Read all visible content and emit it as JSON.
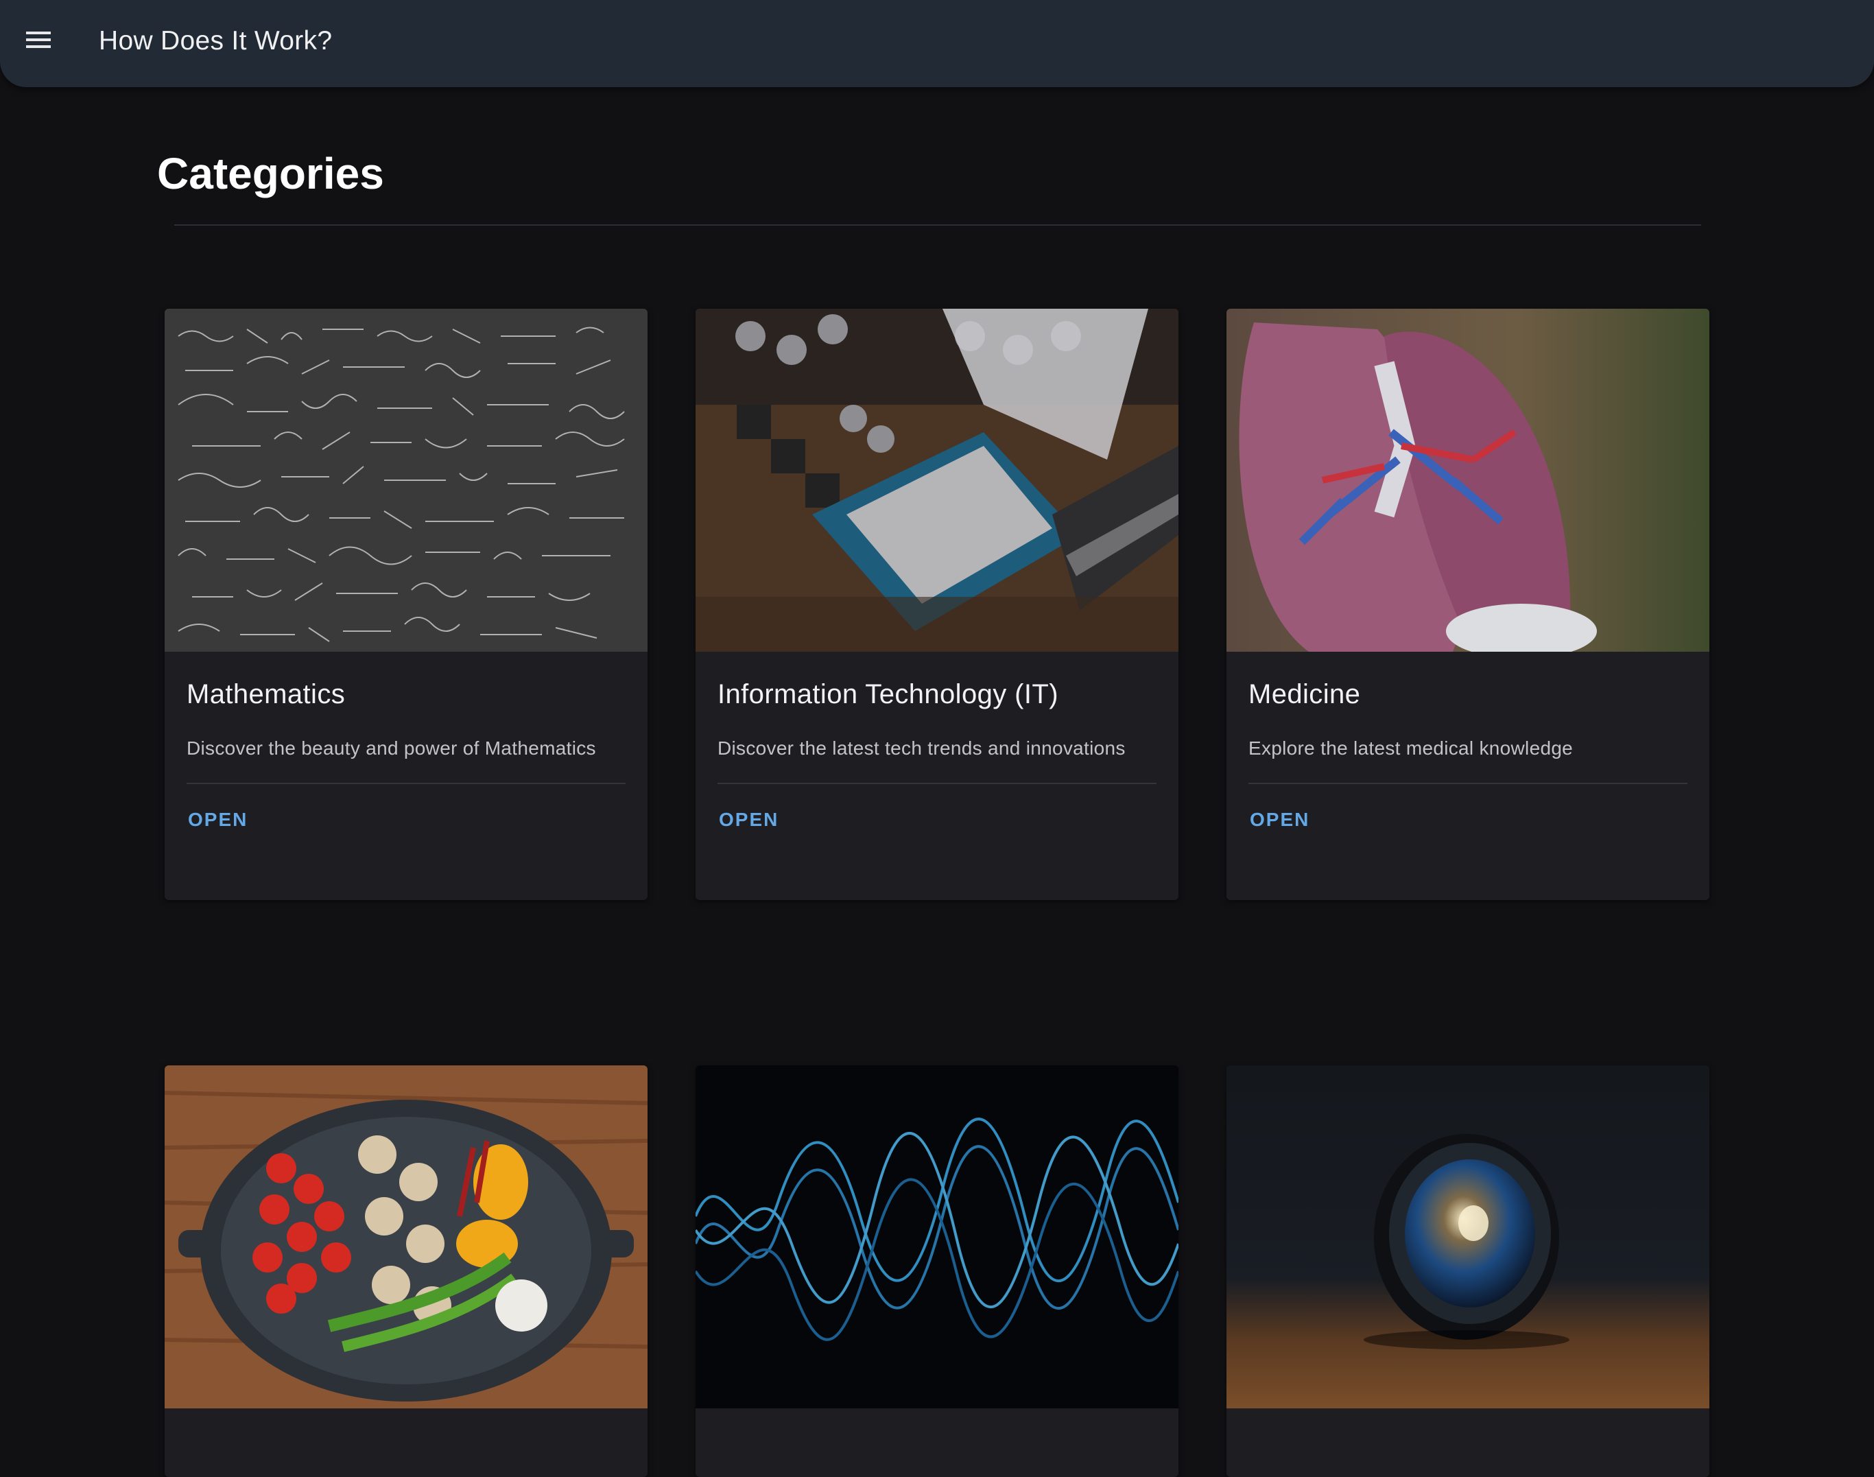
{
  "appbar": {
    "title": "How Does It Work?",
    "menu_icon": "menu-icon"
  },
  "page": {
    "heading": "Categories"
  },
  "accent_color": "#64a8e6",
  "cards": [
    {
      "title": "Mathematics",
      "description": "Discover the beauty and power of Mathematics",
      "action": "OPEN",
      "image": "chalkboard-equations-image"
    },
    {
      "title": "Information Technology (IT)",
      "description": "Discover the latest tech trends and innovations",
      "action": "OPEN",
      "image": "cpu-motherboard-image"
    },
    {
      "title": "Medicine",
      "description": "Explore the latest medical knowledge",
      "action": "OPEN",
      "image": "lung-model-image"
    },
    {
      "image": "vegetables-pan-image"
    },
    {
      "image": "blue-sound-wave-image"
    },
    {
      "image": "camera-lens-image"
    }
  ]
}
